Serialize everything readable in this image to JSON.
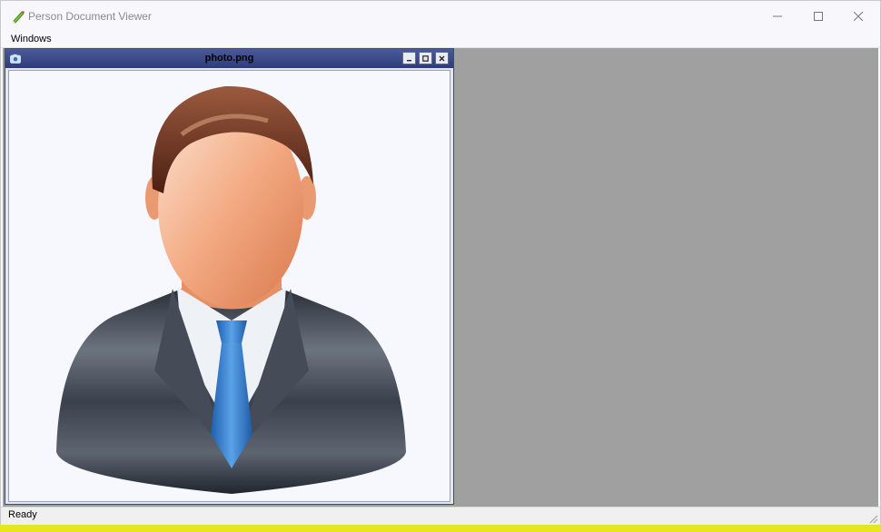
{
  "window": {
    "title": "Person Document Viewer"
  },
  "menubar": {
    "items": [
      {
        "label": "Windows"
      }
    ]
  },
  "child_window": {
    "title": "photo.png"
  },
  "statusbar": {
    "text": "Ready"
  },
  "icons": {
    "app": "pencil-icon",
    "minimize": "minimize-icon",
    "maximize": "maximize-icon",
    "close": "close-icon",
    "child_camera": "camera-icon"
  },
  "colors": {
    "mdi_background": "#a0a0a0",
    "child_titlebar": "#3a4a88",
    "suit": "#3c4450",
    "tie": "#2f77c8",
    "hair": "#6e3420",
    "skin": "#f2a57c",
    "accent_stripe": "#e6e61e"
  }
}
